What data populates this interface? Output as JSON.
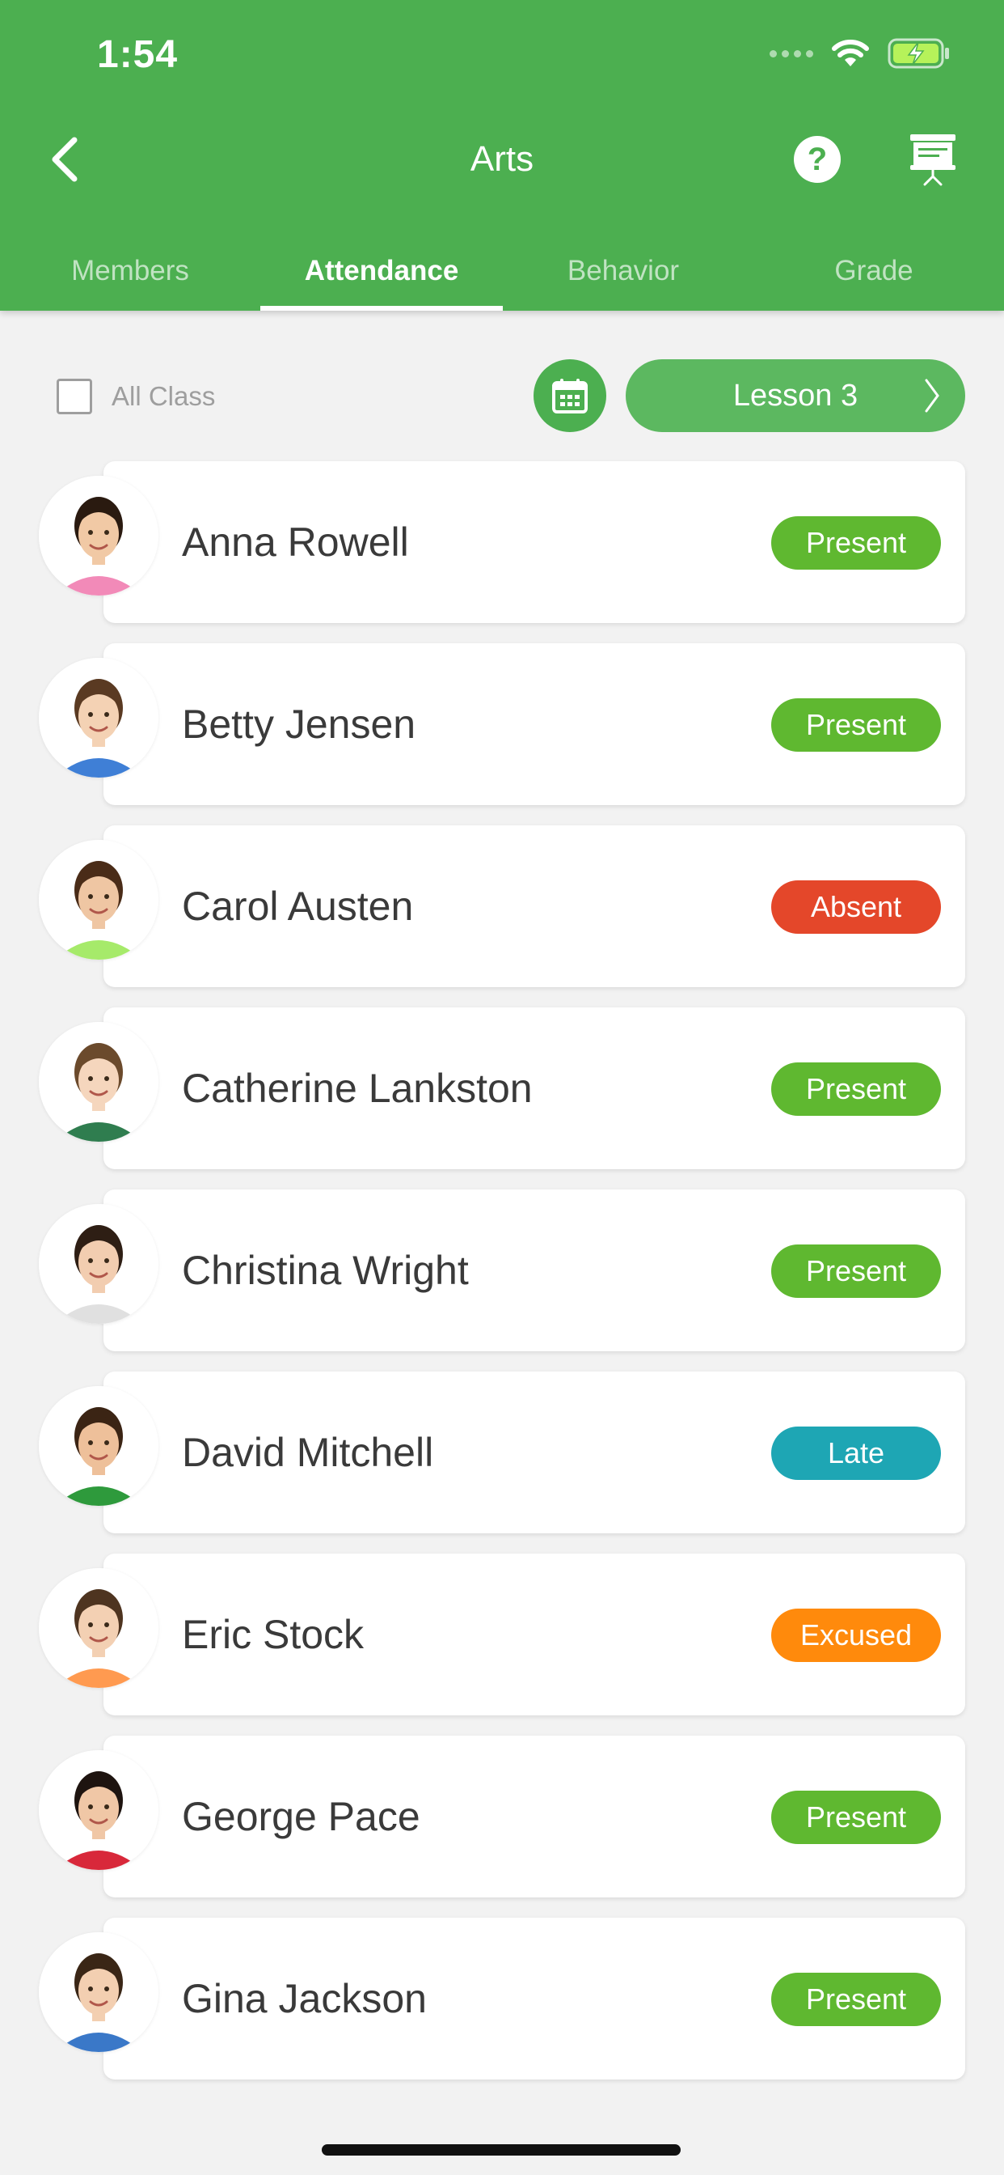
{
  "status_bar": {
    "time": "1:54"
  },
  "header": {
    "title": "Arts",
    "help_label": "?"
  },
  "tabs": [
    {
      "label": "Members",
      "active": false
    },
    {
      "label": "Attendance",
      "active": true
    },
    {
      "label": "Behavior",
      "active": false
    },
    {
      "label": "Grade",
      "active": false
    }
  ],
  "toolbar": {
    "all_class_label": "All Class",
    "all_class_checked": false,
    "lesson_label": "Lesson 3"
  },
  "colors": {
    "primary": "#4caf50",
    "present": "#5fb830",
    "absent": "#e4472a",
    "late": "#1ea6b4",
    "excused": "#ff8a0c"
  },
  "students": [
    {
      "name": "Anna Rowell",
      "status": "Present",
      "status_key": "present",
      "avatar": "child-girl-pigtails"
    },
    {
      "name": "Betty Jensen",
      "status": "Present",
      "status_key": "present",
      "avatar": "child-girl-brown-hair"
    },
    {
      "name": "Carol Austen",
      "status": "Absent",
      "status_key": "absent",
      "avatar": "child-girl-long-hair"
    },
    {
      "name": "Catherine Lankston",
      "status": "Present",
      "status_key": "present",
      "avatar": "child-girl-headband"
    },
    {
      "name": "Christina Wright",
      "status": "Present",
      "status_key": "present",
      "avatar": "child-girl-dark-hair"
    },
    {
      "name": "David Mitchell",
      "status": "Late",
      "status_key": "late",
      "avatar": "child-boy-green-shirt"
    },
    {
      "name": "Eric Stock",
      "status": "Excused",
      "status_key": "excused",
      "avatar": "child-boy-orange-shirt"
    },
    {
      "name": "George Pace",
      "status": "Present",
      "status_key": "present",
      "avatar": "child-boy-red-shirt"
    },
    {
      "name": "Gina Jackson",
      "status": "Present",
      "status_key": "present",
      "avatar": "child-girl-braids"
    }
  ]
}
